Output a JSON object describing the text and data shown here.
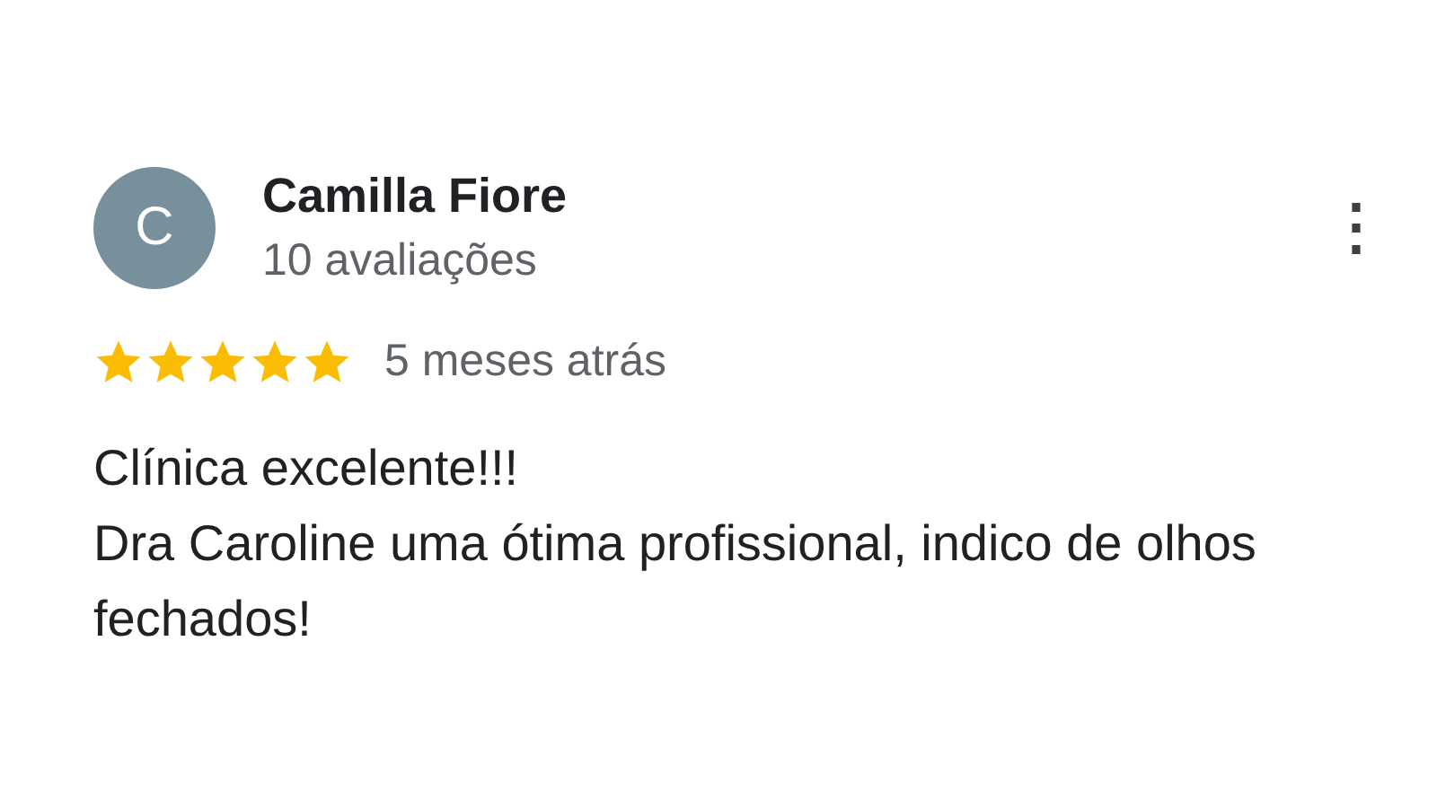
{
  "review": {
    "avatar_letter": "C",
    "author": "Camilla Fiore",
    "review_count": "10 avaliações",
    "menu_glyph": "⋮",
    "stars": 5,
    "time": "5 meses atrás",
    "text": "Clínica excelente!!!\nDra Caroline uma ótima profissional, indico de olhos fechados!"
  }
}
